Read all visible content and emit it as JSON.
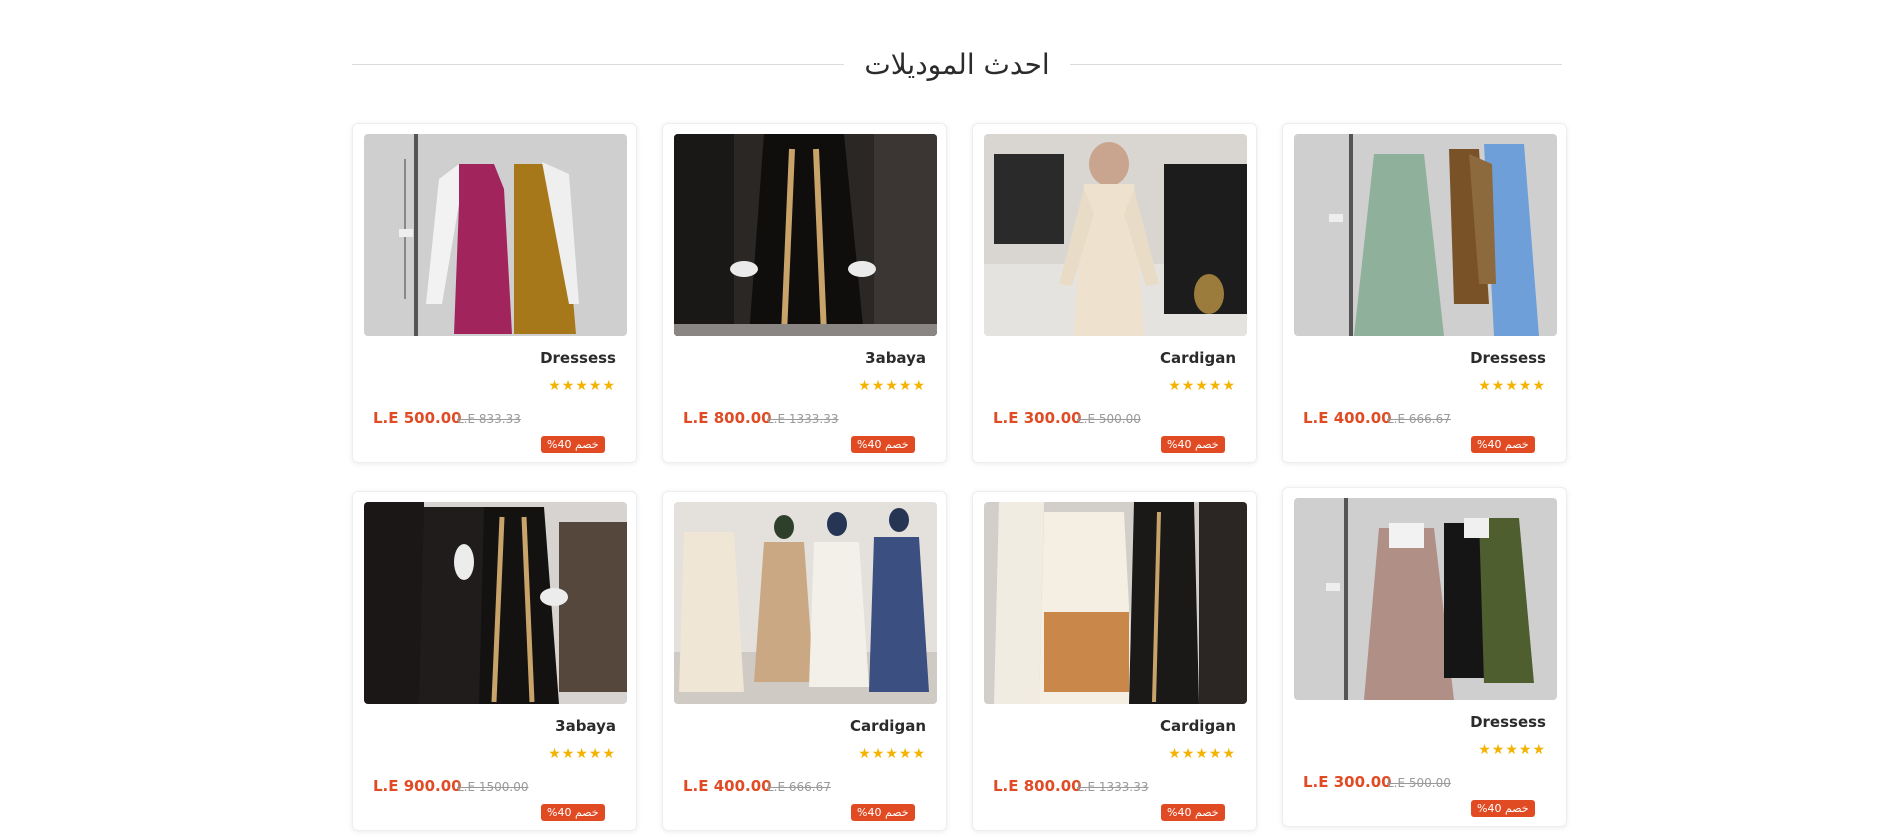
{
  "section": {
    "title": "احدث الموديلات"
  },
  "products": [
    {
      "name": "Dressess",
      "stars": "★★★★★",
      "price": "L.E 500.00",
      "old_price": "L.E 833.33",
      "badge": "خصم 40%",
      "image": "dress-photo"
    },
    {
      "name": "3abaya",
      "stars": "★★★★★",
      "price": "L.E 800.00",
      "old_price": "L.E 1333.33",
      "badge": "خصم 40%",
      "image": "abaya-photo"
    },
    {
      "name": "Cardigan",
      "stars": "★★★★★",
      "price": "L.E 300.00",
      "old_price": "L.E 500.00",
      "badge": "خصم 40%",
      "image": "cardigan-photo"
    },
    {
      "name": "Dressess",
      "stars": "★★★★★",
      "price": "L.E 400.00",
      "old_price": "L.E 666.67",
      "badge": "خصم 40%",
      "image": "dress-photo"
    },
    {
      "name": "3abaya",
      "stars": "★★★★★",
      "price": "L.E 900.00",
      "old_price": "L.E 1500.00",
      "badge": "خصم 40%",
      "image": "abaya-photo"
    },
    {
      "name": "Cardigan",
      "stars": "★★★★★",
      "price": "L.E 400.00",
      "old_price": "L.E 666.67",
      "badge": "خصم 40%",
      "image": "cardigan-photo"
    },
    {
      "name": "Cardigan",
      "stars": "★★★★★",
      "price": "L.E 800.00",
      "old_price": "L.E 1333.33",
      "badge": "خصم 40%",
      "image": "cardigan-photo"
    },
    {
      "name": "Dressess",
      "stars": "★★★★★",
      "price": "L.E 300.00",
      "old_price": "L.E 500.00",
      "badge": "خصم 40%",
      "image": "dress-photo"
    }
  ],
  "colors": {
    "accent": "#e04b24",
    "star": "#f5b301",
    "text": "#2b2b2b"
  }
}
